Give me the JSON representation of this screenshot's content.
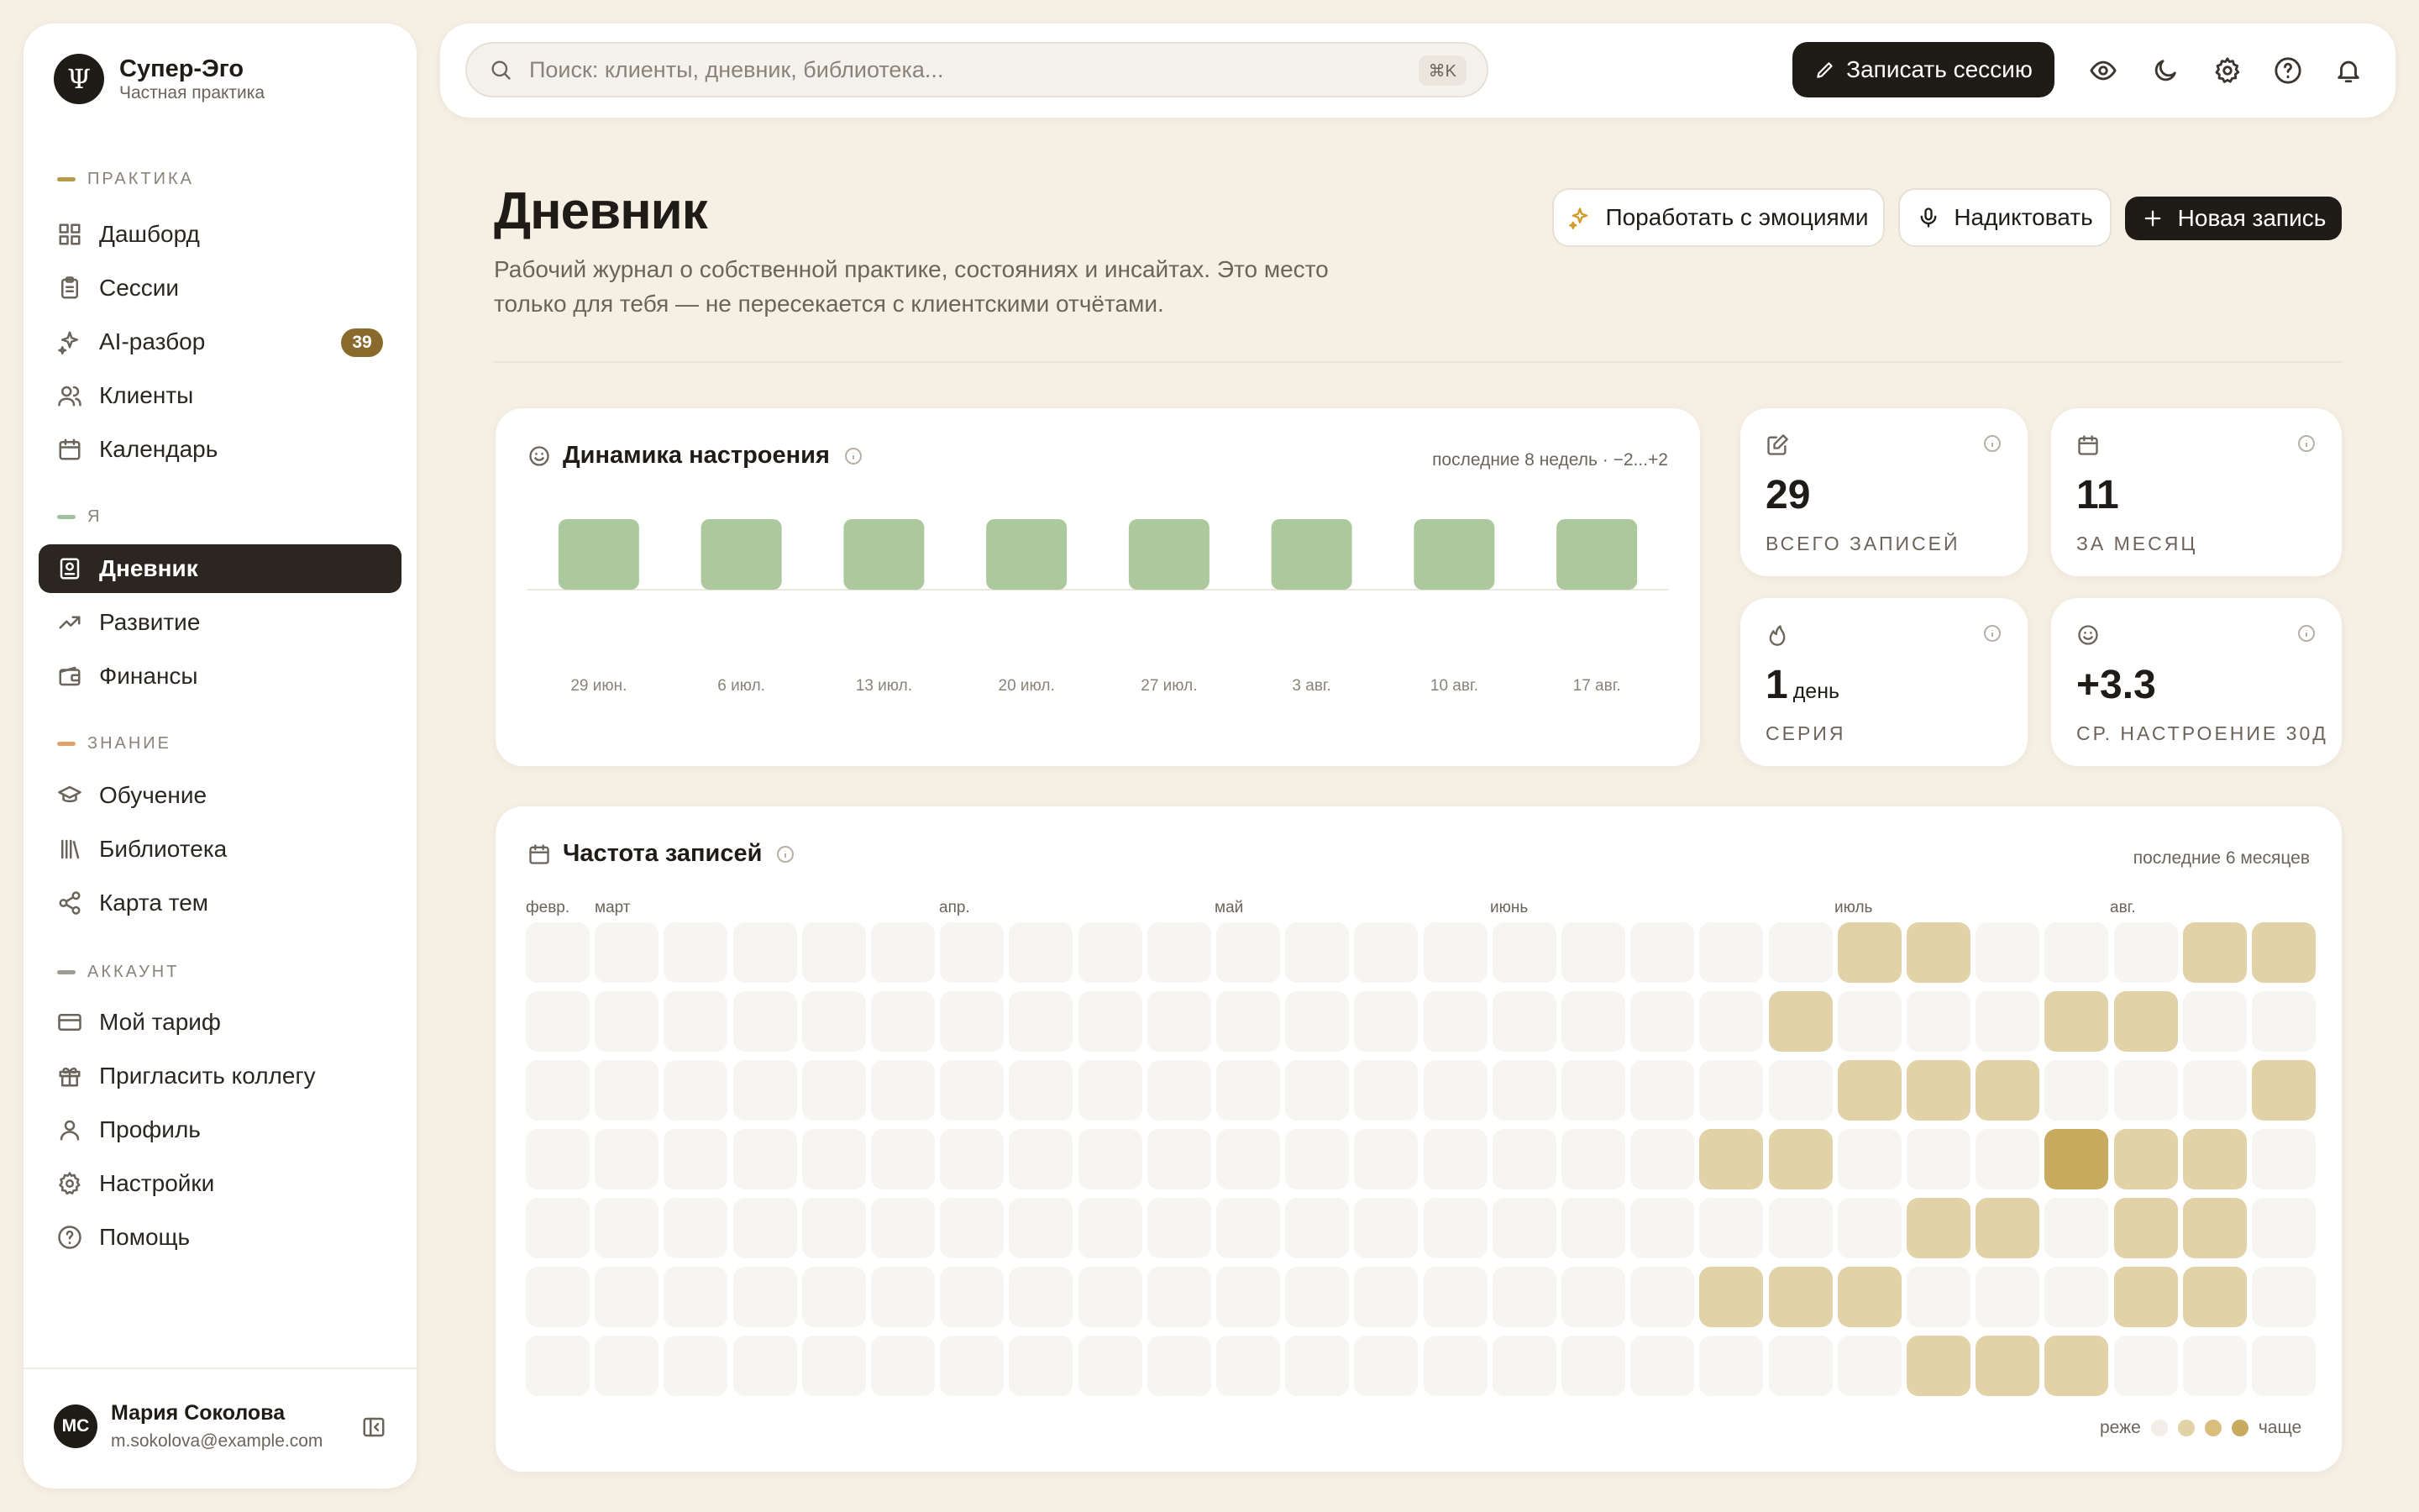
{
  "brand": {
    "logo": "Ψ",
    "name": "Супер-Эго",
    "subtitle": "Частная практика"
  },
  "sidebar": {
    "sections": [
      {
        "label": "ПРАКТИКА",
        "accent": "#b59a4a"
      },
      {
        "label": "Я",
        "accent": "#9ec39a"
      },
      {
        "label": "ЗНАНИЕ",
        "accent": "#e0a46a"
      },
      {
        "label": "АККАУНТ",
        "accent": "#a09a92"
      }
    ],
    "items": [
      {
        "label": "Дашборд",
        "icon": "grid-icon"
      },
      {
        "label": "Сессии",
        "icon": "clipboard-icon"
      },
      {
        "label": "AI-разбор",
        "icon": "sparkles-icon",
        "badge": "39"
      },
      {
        "label": "Клиенты",
        "icon": "users-icon"
      },
      {
        "label": "Календарь",
        "icon": "calendar-icon"
      },
      {
        "label": "Дневник",
        "icon": "journal-icon",
        "active": true
      },
      {
        "label": "Развитие",
        "icon": "trending-icon"
      },
      {
        "label": "Финансы",
        "icon": "wallet-icon"
      },
      {
        "label": "Обучение",
        "icon": "graduation-icon"
      },
      {
        "label": "Библиотека",
        "icon": "library-icon"
      },
      {
        "label": "Карта тем",
        "icon": "share-icon"
      },
      {
        "label": "Мой тариф",
        "icon": "card-icon"
      },
      {
        "label": "Пригласить коллегу",
        "icon": "gift-icon"
      },
      {
        "label": "Профиль",
        "icon": "user-icon"
      },
      {
        "label": "Настройки",
        "icon": "gear-icon"
      },
      {
        "label": "Помощь",
        "icon": "help-icon"
      }
    ]
  },
  "user": {
    "initials": "МС",
    "name": "Мария Соколова",
    "email": "m.sokolova@example.com"
  },
  "topbar": {
    "search_placeholder": "Поиск: клиенты, дневник, библиотека...",
    "search_shortcut": "⌘K",
    "record_label": "Записать сессию"
  },
  "page": {
    "title": "Дневник",
    "description": "Рабочий журнал о собственной практике, состояниях и инсайтах. Это место только для тебя — не пересекается с клиентскими отчётами.",
    "buttons": {
      "emotions": "Поработать с эмоциями",
      "dictate": "Надиктовать",
      "new_entry": "Новая запись"
    }
  },
  "mood": {
    "title": "Динамика настроения",
    "meta": "последние 8 недель · −2...+2",
    "bar_color": "#acc99e"
  },
  "stats": [
    {
      "value": "29",
      "unit": "",
      "label": "ВСЕГО ЗАПИСЕЙ",
      "icon": "edit-icon"
    },
    {
      "value": "11",
      "unit": "",
      "label": "ЗА МЕСЯЦ",
      "icon": "calendar-icon"
    },
    {
      "value": "1",
      "unit": "день",
      "label": "СЕРИЯ",
      "icon": "flame-icon"
    },
    {
      "value": "+3.3",
      "unit": "",
      "label": "СР. НАСТРОЕНИЕ 30Д",
      "icon": "smile-icon"
    }
  ],
  "heatmap": {
    "title": "Частота записей",
    "meta": "последние 6 месяцев",
    "months": [
      "февр.",
      "март",
      "апр.",
      "май",
      "июнь",
      "июль",
      "авг."
    ],
    "legend_less": "реже",
    "legend_more": "чаще",
    "colors": [
      "#f7f5f1",
      "#e2d2a8",
      "#c8ab5e"
    ]
  },
  "chart_data": {
    "type": "bar",
    "title": "Динамика настроения",
    "categories": [
      "29 июн.",
      "6 июл.",
      "13 июл.",
      "20 июл.",
      "27 июл.",
      "3 авг.",
      "10 авг.",
      "17 авг."
    ],
    "values": [
      2,
      2,
      2,
      2,
      2,
      2,
      2,
      2
    ],
    "ylim": [
      -2,
      2
    ],
    "xlabel": "",
    "ylabel": ""
  }
}
